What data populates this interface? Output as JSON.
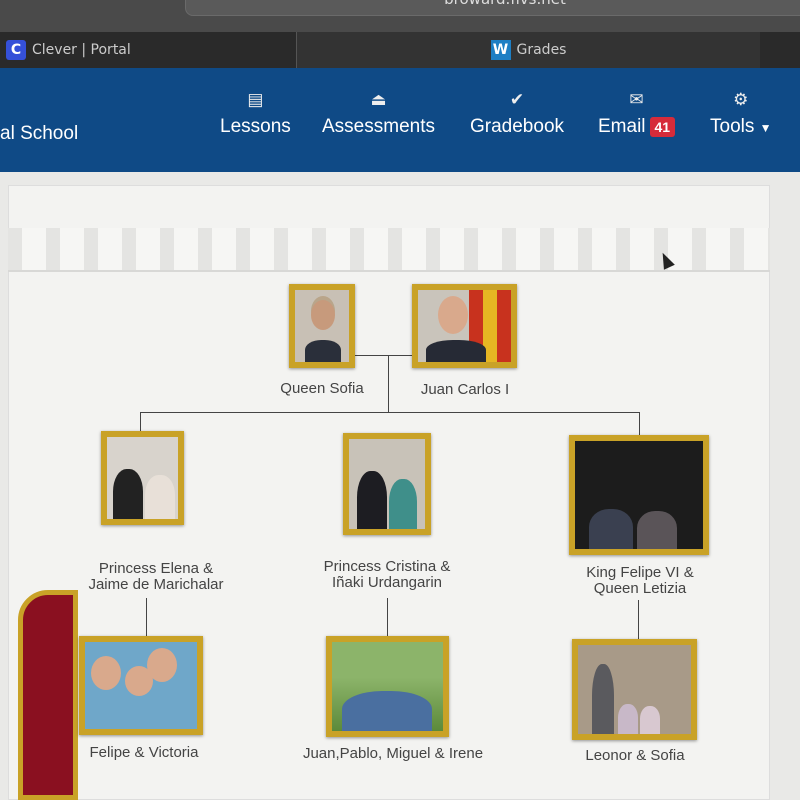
{
  "browser": {
    "url": "broward.flvs.net",
    "tabs": [
      {
        "label": "Clever | Portal",
        "icon": "C"
      },
      {
        "label": "Grades",
        "icon": "W"
      }
    ]
  },
  "nav": {
    "school": "al School",
    "items": [
      {
        "label": "Lessons",
        "icon": "book-icon"
      },
      {
        "label": "Assessments",
        "icon": "inbox-icon"
      },
      {
        "label": "Gradebook",
        "icon": "check-icon"
      },
      {
        "label": "Email",
        "icon": "envelope-icon",
        "badge": "41"
      },
      {
        "label": "Tools",
        "icon": "gear-icon"
      }
    ]
  },
  "tree": {
    "grandparents": [
      "Queen Sofia",
      "Juan Carlos I"
    ],
    "children": [
      {
        "line1": "Princess Elena &",
        "line2": "Jaime de Marichalar"
      },
      {
        "line1": "Princess Cristina &",
        "line2": "Iñaki Urdangarin"
      },
      {
        "line1": "King Felipe VI &",
        "line2": "Queen Letizia"
      }
    ],
    "grandchildren": [
      "Felipe & Victoria",
      "Juan,Pablo, Miguel & Irene",
      "Leonor & Sofia"
    ]
  },
  "colors": {
    "nav": "#0f4a86",
    "frame": "#c9a227",
    "badge": "#d62b3a"
  }
}
